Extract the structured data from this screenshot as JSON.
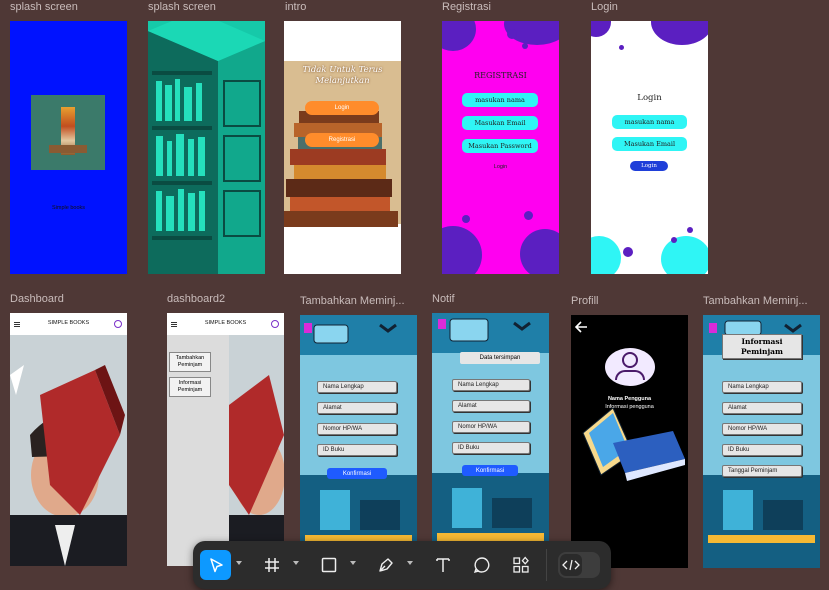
{
  "canvas": {
    "background": "#4f3836"
  },
  "frames": {
    "splash1": {
      "label": "splash screen",
      "caption": "Simple books",
      "bg": "#0012ff"
    },
    "splash2": {
      "label": "splash screen"
    },
    "intro": {
      "label": "intro",
      "heading": "Tidak Untuk Terus Melanjutkan",
      "login": "Login",
      "register": "Registrasi"
    },
    "registrasi": {
      "label": "Registrasi",
      "title": "REGISTRASI",
      "name": "masukan nama",
      "email": "Masukan Email",
      "password": "Masukan Password",
      "login": "Login"
    },
    "login": {
      "label": "Login",
      "title": "Login",
      "name": "masukan nama",
      "email": "Masukan Email",
      "button": "Login"
    },
    "dashboard": {
      "label": "Dashboard",
      "title": "SIMPLE BOOKS"
    },
    "dashboard2": {
      "label": "dashboard2",
      "title": "SIMPLE BOOKS",
      "menu_add": "Tambahkan Peminjam",
      "menu_info": "Informasi Peminjam"
    },
    "tambah": {
      "label": "Tambahkan Meminj...",
      "name": "Nama Lengkap",
      "address": "Alamat",
      "phone": "Nomor HP/WA",
      "book": "ID Buku",
      "confirm": "Konfirmasi"
    },
    "notif": {
      "label": "Notif",
      "saved": "Data tersimpan",
      "name": "Nama Lengkap",
      "address": "Alamat",
      "phone": "Nomor HP/WA",
      "book": "ID Buku",
      "confirm": "Konfirmasi"
    },
    "profil": {
      "label": "Profill",
      "username": "Nama Pengguna",
      "info": "Informasi pengguna"
    },
    "info": {
      "label": "Tambahkan Meminj...",
      "title": "Informasi Peminjam",
      "name": "Nama Lengkap",
      "address": "Alamat",
      "phone": "Nomor HP/WA",
      "book": "ID Buku",
      "date": "Tanggal Peminjam"
    }
  },
  "toolbar": {
    "tools": [
      "move-tool",
      "frame-tool",
      "shape-tool",
      "pen-tool",
      "text-tool",
      "comment-tool",
      "actions-tool",
      "dev-mode-toggle"
    ],
    "active": "move-tool",
    "accent": "#0d99ff"
  }
}
